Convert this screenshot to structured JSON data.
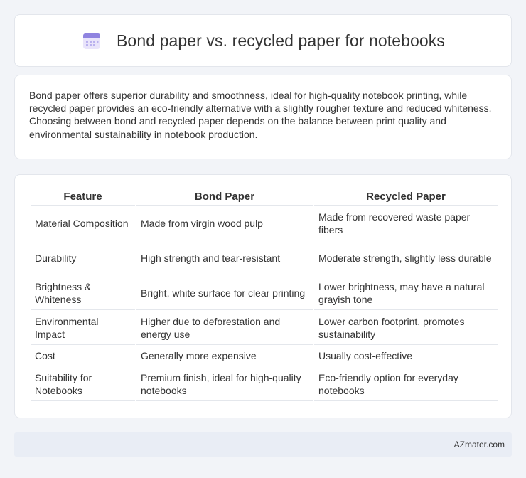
{
  "header": {
    "title": "Bond paper vs. recycled paper for notebooks",
    "icon": "calendar-icon",
    "icon_color": "#7b6fd6"
  },
  "intro": {
    "text": "Bond paper offers superior durability and smoothness, ideal for high-quality notebook printing, while recycled paper provides an eco-friendly alternative with a slightly rougher texture and reduced whiteness. Choosing between bond and recycled paper depends on the balance between print quality and environmental sustainability in notebook production."
  },
  "table": {
    "headers": [
      "Feature",
      "Bond Paper",
      "Recycled Paper"
    ],
    "rows": [
      [
        "Material Composition",
        "Made from virgin wood pulp",
        "Made from recovered waste paper fibers"
      ],
      [
        "Durability",
        "High strength and tear-resistant",
        "Moderate strength, slightly less durable"
      ],
      [
        "Brightness & Whiteness",
        "Bright, white surface for clear printing",
        "Lower brightness, may have a natural grayish tone"
      ],
      [
        "Environmental Impact",
        "Higher due to deforestation and energy use",
        "Lower carbon footprint, promotes sustainability"
      ],
      [
        "Cost",
        "Generally more expensive",
        "Usually cost-effective"
      ],
      [
        "Suitability for Notebooks",
        "Premium finish, ideal for high-quality notebooks",
        "Eco-friendly option for everyday notebooks"
      ]
    ]
  },
  "footer": {
    "brand": "AZmater.com"
  }
}
